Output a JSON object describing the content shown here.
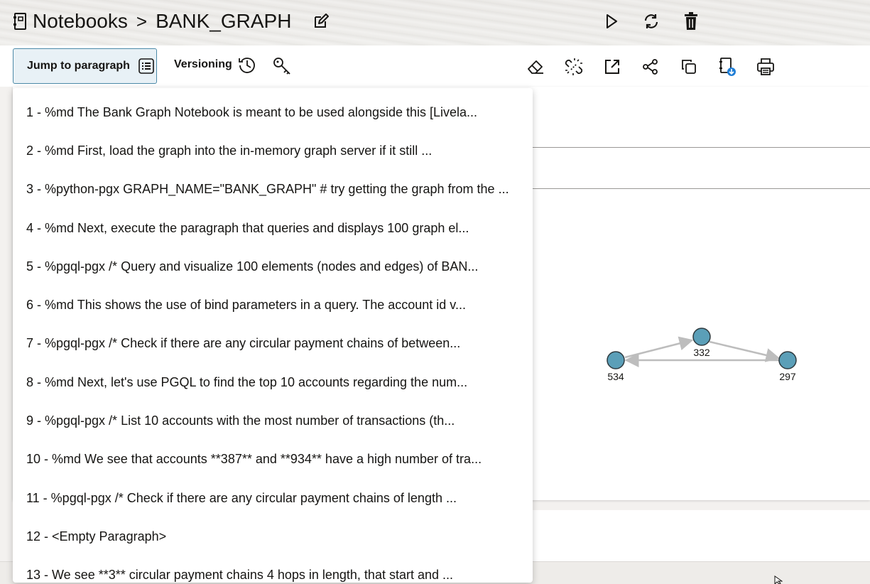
{
  "header": {
    "breadcrumb_root": "Notebooks",
    "separator": ">",
    "notebook_name": "BANK_GRAPH",
    "icons": [
      "notebook-icon",
      "edit-icon",
      "run-icon",
      "refresh-icon",
      "trash-icon"
    ]
  },
  "toolbar": {
    "jump_label": "Jump to paragraph",
    "versioning_label": "Versioning",
    "icons": [
      "list-icon",
      "history-icon",
      "key-icon",
      "eraser-icon",
      "unlink-icon",
      "external-link-icon",
      "share-icon",
      "copy-icon",
      "import-notebook-icon",
      "print-icon"
    ]
  },
  "paragraphs": [
    "1 - %md The Bank Graph Notebook is meant to be used alongside this [Livela...",
    "2 - %md First, load the graph into the in-memory graph server if it still ...",
    "3 - %python-pgx GRAPH_NAME=\"BANK_GRAPH\" # try getting the graph from the ...",
    "4 - %md Next, execute the paragraph that queries and displays 100 graph el...",
    "5 - %pgql-pgx /* Query and visualize 100 elements (nodes and edges) of BAN...",
    "6 - %md This shows the use of bind parameters in a query. The account id v...",
    "7 - %pgql-pgx /* Check if there are any circular payment chains of between...",
    "8 - %md Next, let's use PGQL to find the top 10 accounts regarding the num...",
    "9 - %pgql-pgx /* List 10 accounts with the most number of transactions (th...",
    "10 - %md We see that accounts **387** and **934** have a high number of tra...",
    "11 - %pgql-pgx /* Check if there are any circular payment chains of length ...",
    "12 - <Empty Paragraph>",
    "13 - We see **3** circular payment chains 4 hops in length, that start and ..."
  ],
  "graph": {
    "nodes": [
      {
        "id": "534"
      },
      {
        "id": "332"
      },
      {
        "id": "297"
      }
    ],
    "edges": [
      {
        "from": "534",
        "to": "332"
      },
      {
        "from": "332",
        "to": "297"
      },
      {
        "from": "297",
        "to": "534"
      }
    ],
    "node_color": "#5b9fb8",
    "edge_color": "#bdbdbd"
  },
  "colors": {
    "accent": "#4c8aa8",
    "accent_bg": "#e8f1f6",
    "badge_blue": "#1f7ed6"
  }
}
